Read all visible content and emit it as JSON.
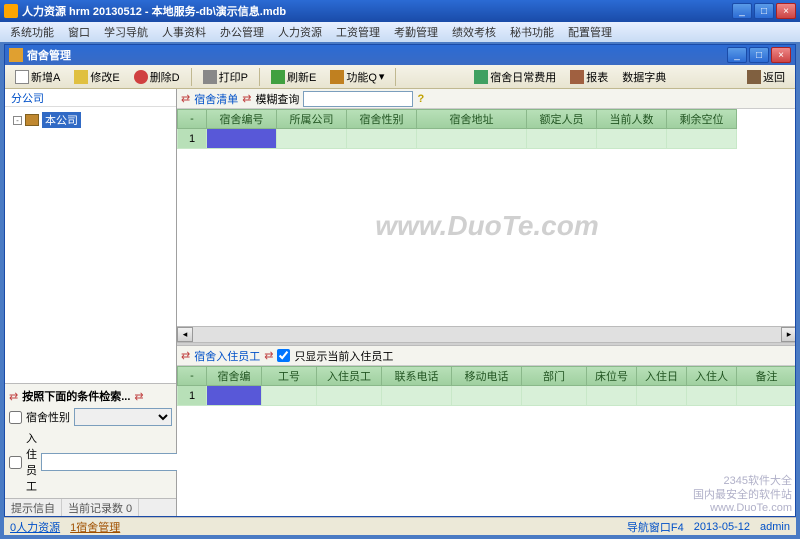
{
  "window": {
    "title": "人力资源 hrm 20130512 - 本地服务-db\\演示信息.mdb"
  },
  "menu": [
    "系统功能",
    "窗口",
    "学习导航",
    "人事资料",
    "办公管理",
    "人力资源",
    "工资管理",
    "考勤管理",
    "绩效考核",
    "秘书功能",
    "配置管理"
  ],
  "child": {
    "title": "宿舍管理"
  },
  "toolbar": {
    "new": "新增A",
    "edit": "修改E",
    "del": "删除D",
    "print": "打印P",
    "refresh": "刷新E",
    "func": "功能Q",
    "daily": "宿舍日常费用",
    "report": "报表",
    "dict": "数据字典",
    "back": "返回"
  },
  "tree": {
    "header": "分公司",
    "root": "本公司"
  },
  "search": {
    "header": "按照下面的条件检索...",
    "field1": "宿舍性别",
    "field2": "入住员工"
  },
  "left_tabs": {
    "t1": "提示信自",
    "t2": "当前记录数 0"
  },
  "top_grid": {
    "title": "宿舍清单",
    "fuzzy": "模糊查询",
    "cols": [
      "-",
      "宿舍编号",
      "所属公司",
      "宿舍性别",
      "宿舍地址",
      "额定人员",
      "当前人数",
      "剩余空位"
    ],
    "row1_idx": "1"
  },
  "bot_grid": {
    "title": "宿舍入住员工",
    "checkbox": "只显示当前入住员工",
    "cols": [
      "-",
      "宿舍编",
      "工号",
      "入住员工",
      "联系电话",
      "移动电话",
      "部门",
      "床位号",
      "入住日",
      "入住人",
      "备注"
    ],
    "row1_idx": "1"
  },
  "watermark": "www.DuoTe.com",
  "status": {
    "link1": "0人力资源",
    "link2": "1宿舍管理",
    "nav": "导航窗口F4",
    "date": "2013-05-12",
    "user": "admin"
  },
  "corner": {
    "l1": "2345软件大全",
    "l2": "国内最安全的软件站",
    "l3": "www.DuoTe.com"
  }
}
